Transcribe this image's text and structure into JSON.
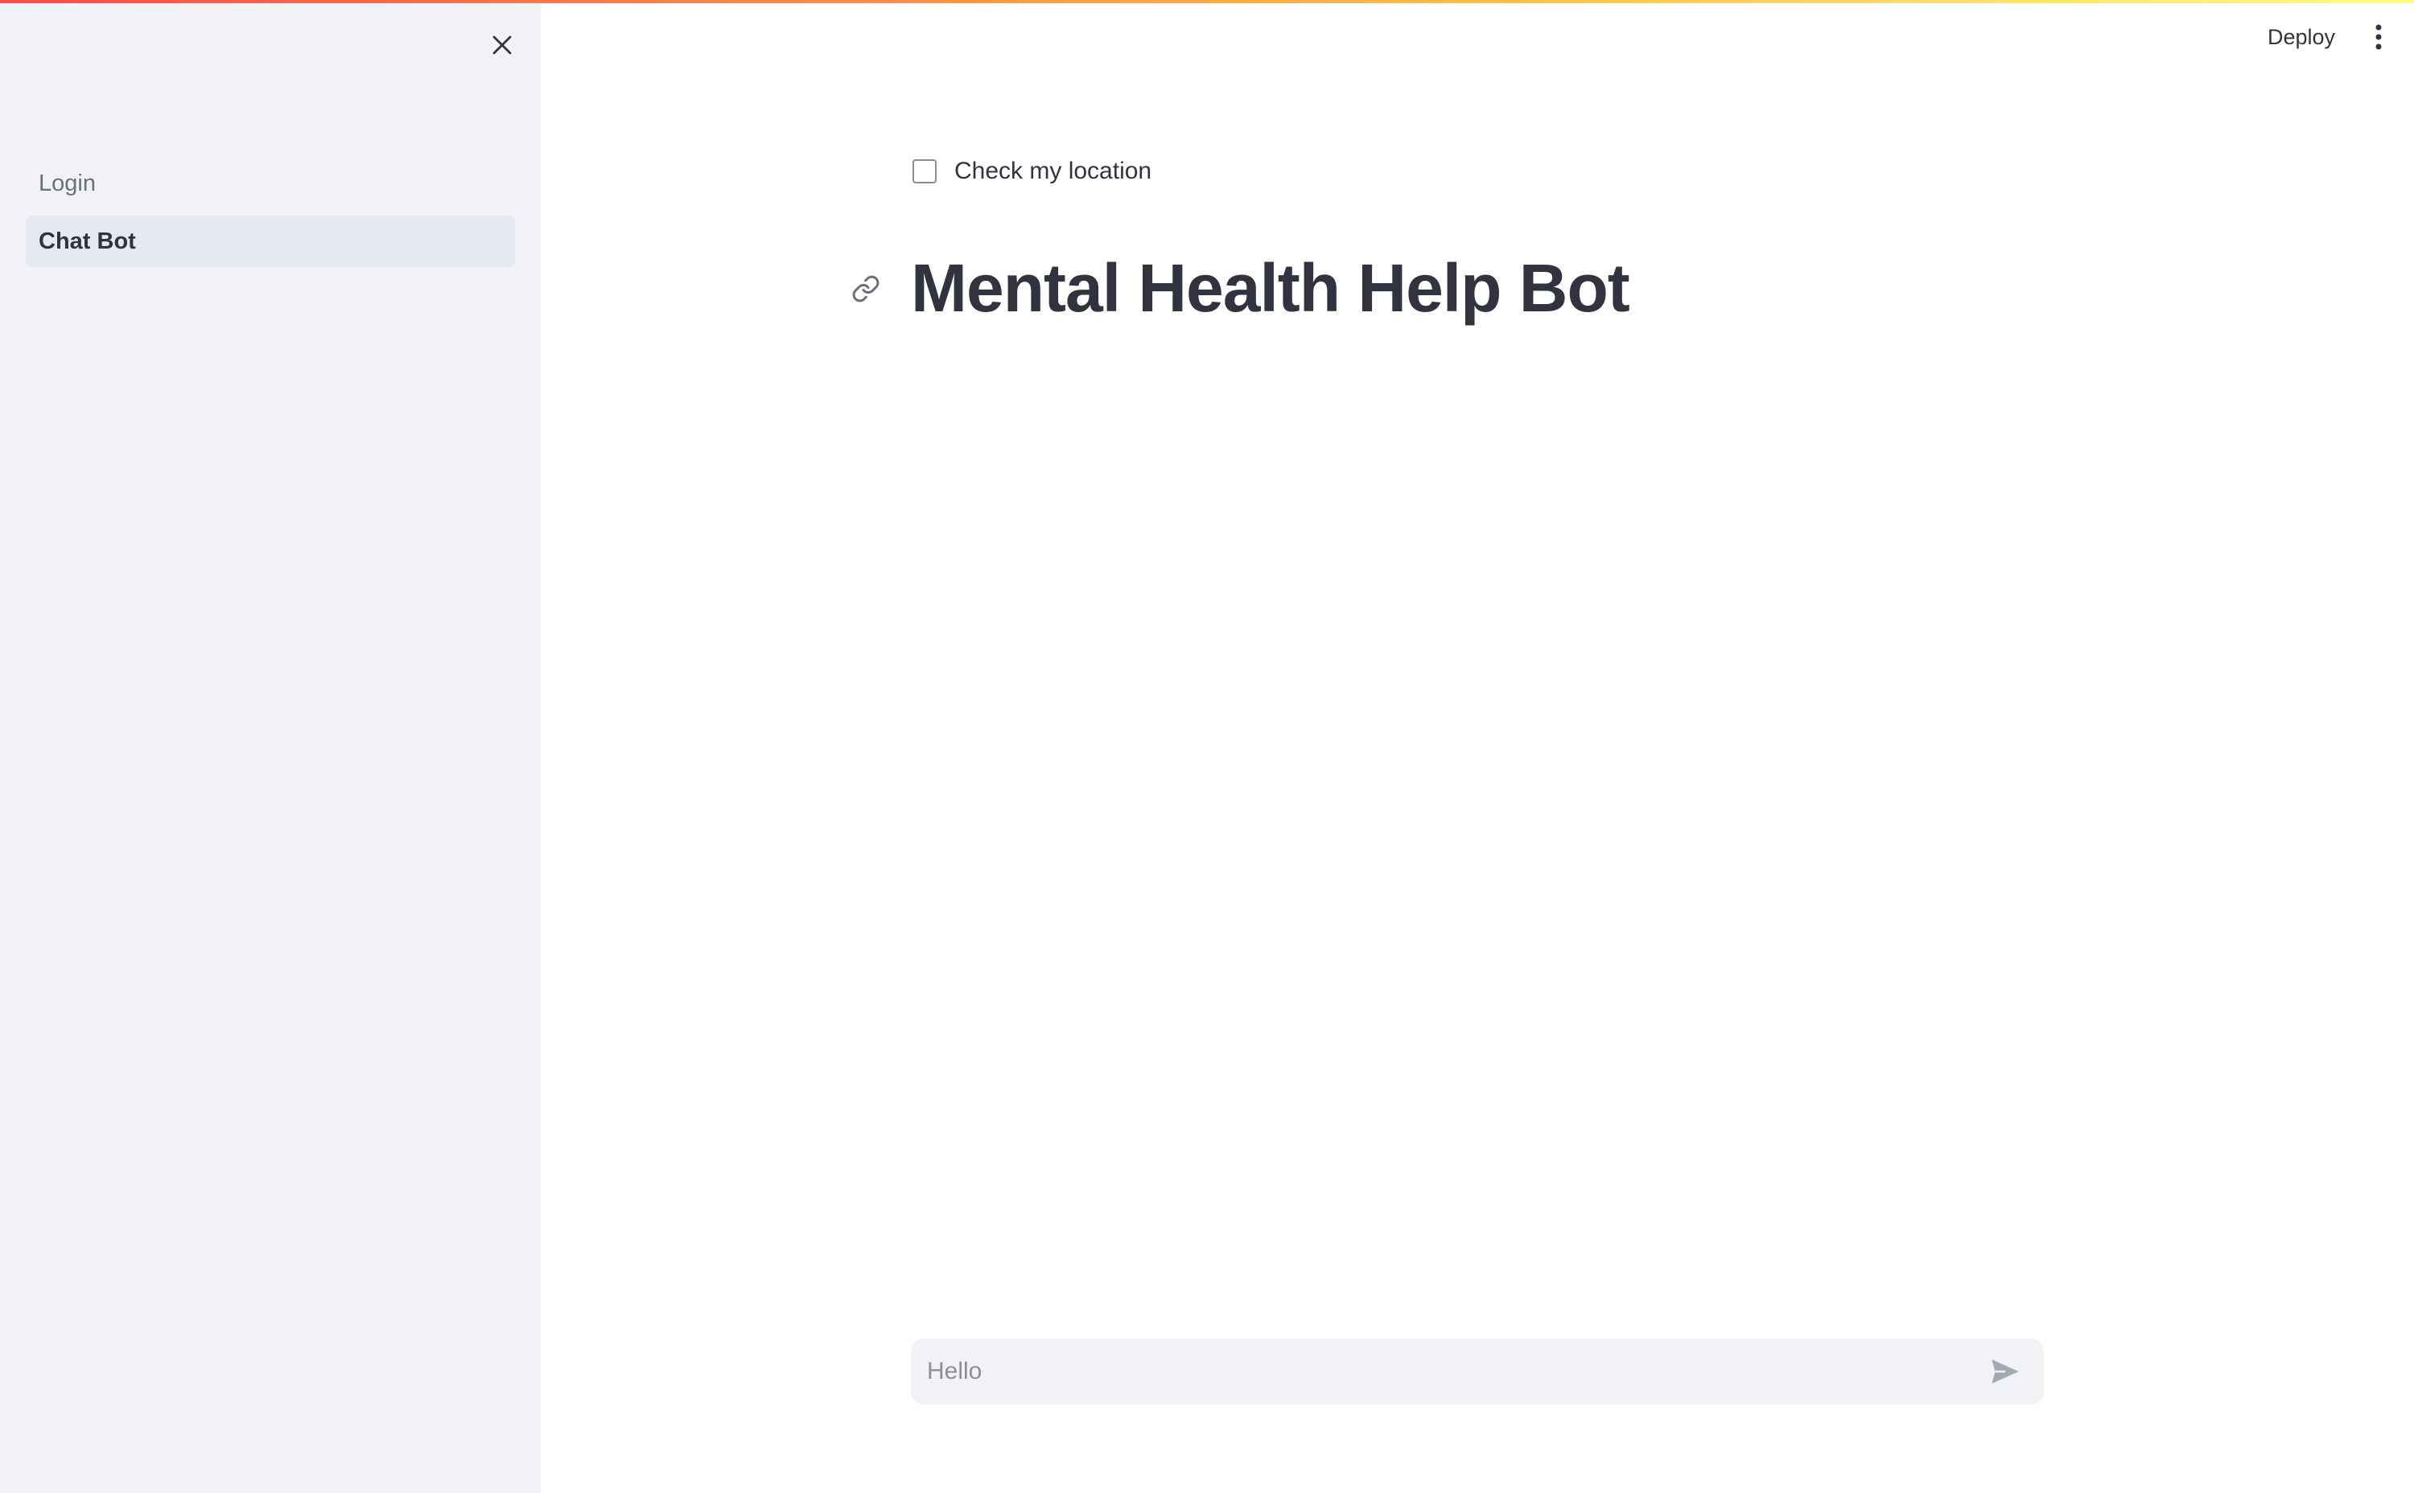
{
  "colors": {
    "sidebar_bg": "#f0f2f6",
    "active_item_bg": "#e6e9ef",
    "text": "#31333f",
    "muted_text": "#6b6f7a",
    "gradient": [
      "#ff4b4b",
      "#ffbd45",
      "#fffd80"
    ]
  },
  "sidebar": {
    "close_icon": "close-icon",
    "items": [
      {
        "label": "Login",
        "active": false
      },
      {
        "label": "Chat Bot",
        "active": true
      }
    ]
  },
  "header": {
    "deploy_label": "Deploy",
    "menu_icon": "vertical-dots-icon"
  },
  "main": {
    "checkbox": {
      "label": "Check my location",
      "checked": false
    },
    "title": "Mental Health Help Bot",
    "title_link_icon": "link-icon"
  },
  "chat_input": {
    "placeholder": "Hello",
    "value": "",
    "send_icon": "send-icon"
  }
}
